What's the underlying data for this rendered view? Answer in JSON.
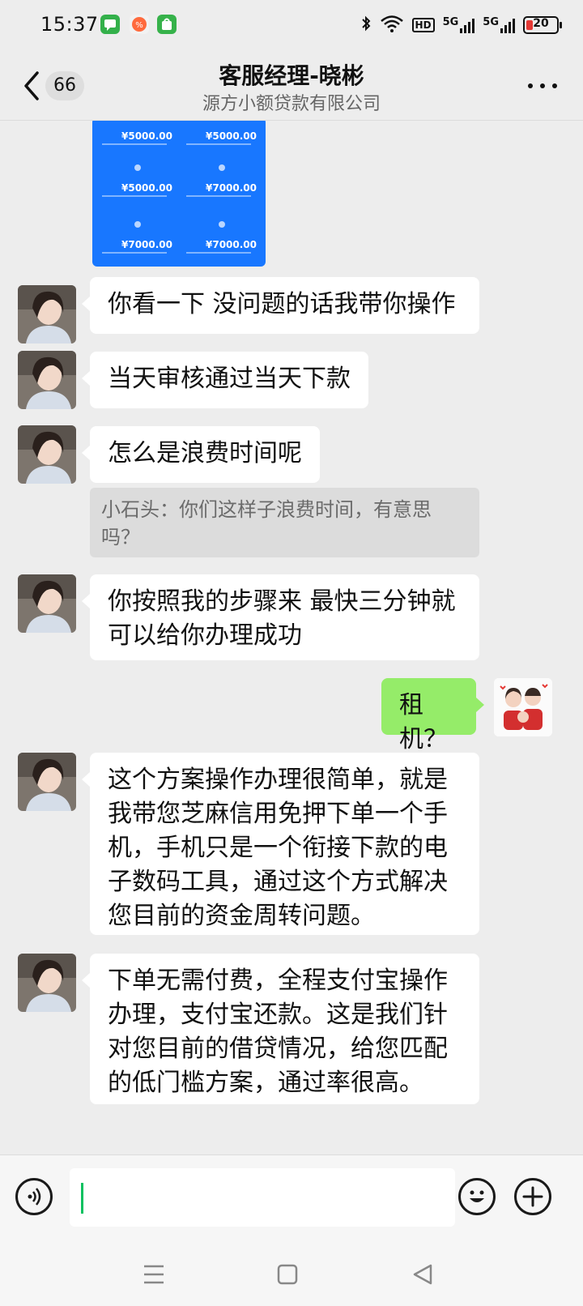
{
  "status_bar": {
    "time": "15:37",
    "network_hd": "HD",
    "network_5g_1": "5G",
    "network_5g_2": "5G",
    "battery": "20",
    "battery_color": "#e53935",
    "app_icons": [
      "chat-notify-icon",
      "app-store-icon",
      "shopping-icon"
    ]
  },
  "header": {
    "unread_count": "66",
    "title": "客服经理-晓彬",
    "subtitle": "源方小额贷款有限公司"
  },
  "image_message": {
    "amounts": [
      "¥5000.00",
      "¥5000.00",
      "¥5000.00",
      "¥7000.00",
      "¥7000.00",
      "¥7000.00"
    ]
  },
  "messages": [
    {
      "side": "left",
      "text": "你看一下 没问题的话我带你操作"
    },
    {
      "side": "left",
      "text": "当天审核通过当天下款"
    },
    {
      "side": "left",
      "text": "怎么是浪费时间呢",
      "quote": "小石头：你们这样子浪费时间，有意思吗？"
    },
    {
      "side": "left",
      "text": "你按照我的步骤来 最快三分钟就可以给你办理成功"
    },
    {
      "side": "right",
      "text": "租机？"
    },
    {
      "side": "left",
      "text": "这个方案操作办理很简单，就是我带您芝麻信用免押下单一个手机，手机只是一个衔接下款的电子数码工具，通过这个方式解决您目前的资金周转问题。"
    },
    {
      "side": "left",
      "text": "下单无需付费，全程支付宝操作办理，支付宝还款。这是我们针对您目前的借贷情况，给您匹配的低门槛方案，通过率很高。"
    }
  ],
  "input_bar": {
    "value": "",
    "accent": "#07c160"
  },
  "colors": {
    "background": "#ededed",
    "bubble_self": "#95ec69",
    "bubble_other": "#ffffff"
  }
}
